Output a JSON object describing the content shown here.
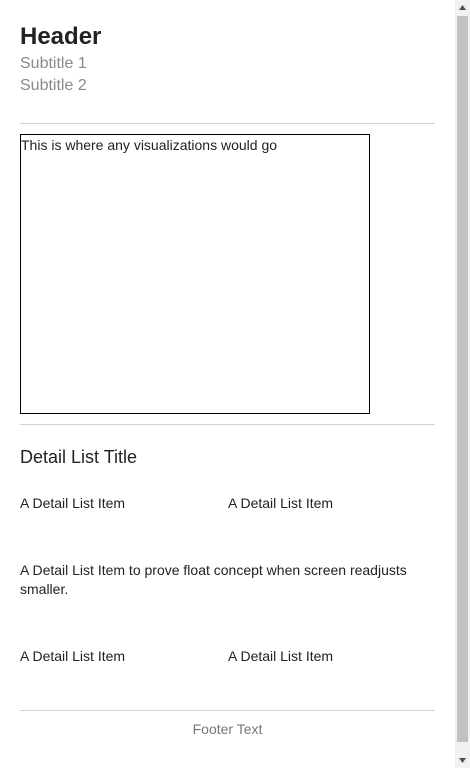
{
  "header": {
    "title": "Header",
    "subtitle_1": "Subtitle 1",
    "subtitle_2": "Subtitle 2"
  },
  "visualization": {
    "placeholder_text": "This is where any visualizations would go"
  },
  "detail_list": {
    "title": "Detail List Title",
    "items": [
      "A Detail List Item",
      "A Detail List Item",
      "A Detail List Item to prove float concept when screen readjusts smaller.",
      "A Detail List Item",
      "A Detail List Item"
    ]
  },
  "footer": {
    "text": "Footer Text"
  },
  "icons": {
    "scroll_up": "triangle-up-icon",
    "scroll_down": "triangle-down-icon"
  },
  "colors": {
    "subtitle": "#8a8a8a",
    "footer": "#777777",
    "divider": "#d4d4d4",
    "scrollbar_thumb": "#c1c1c1",
    "scrollbar_track": "#f1f1f1"
  }
}
